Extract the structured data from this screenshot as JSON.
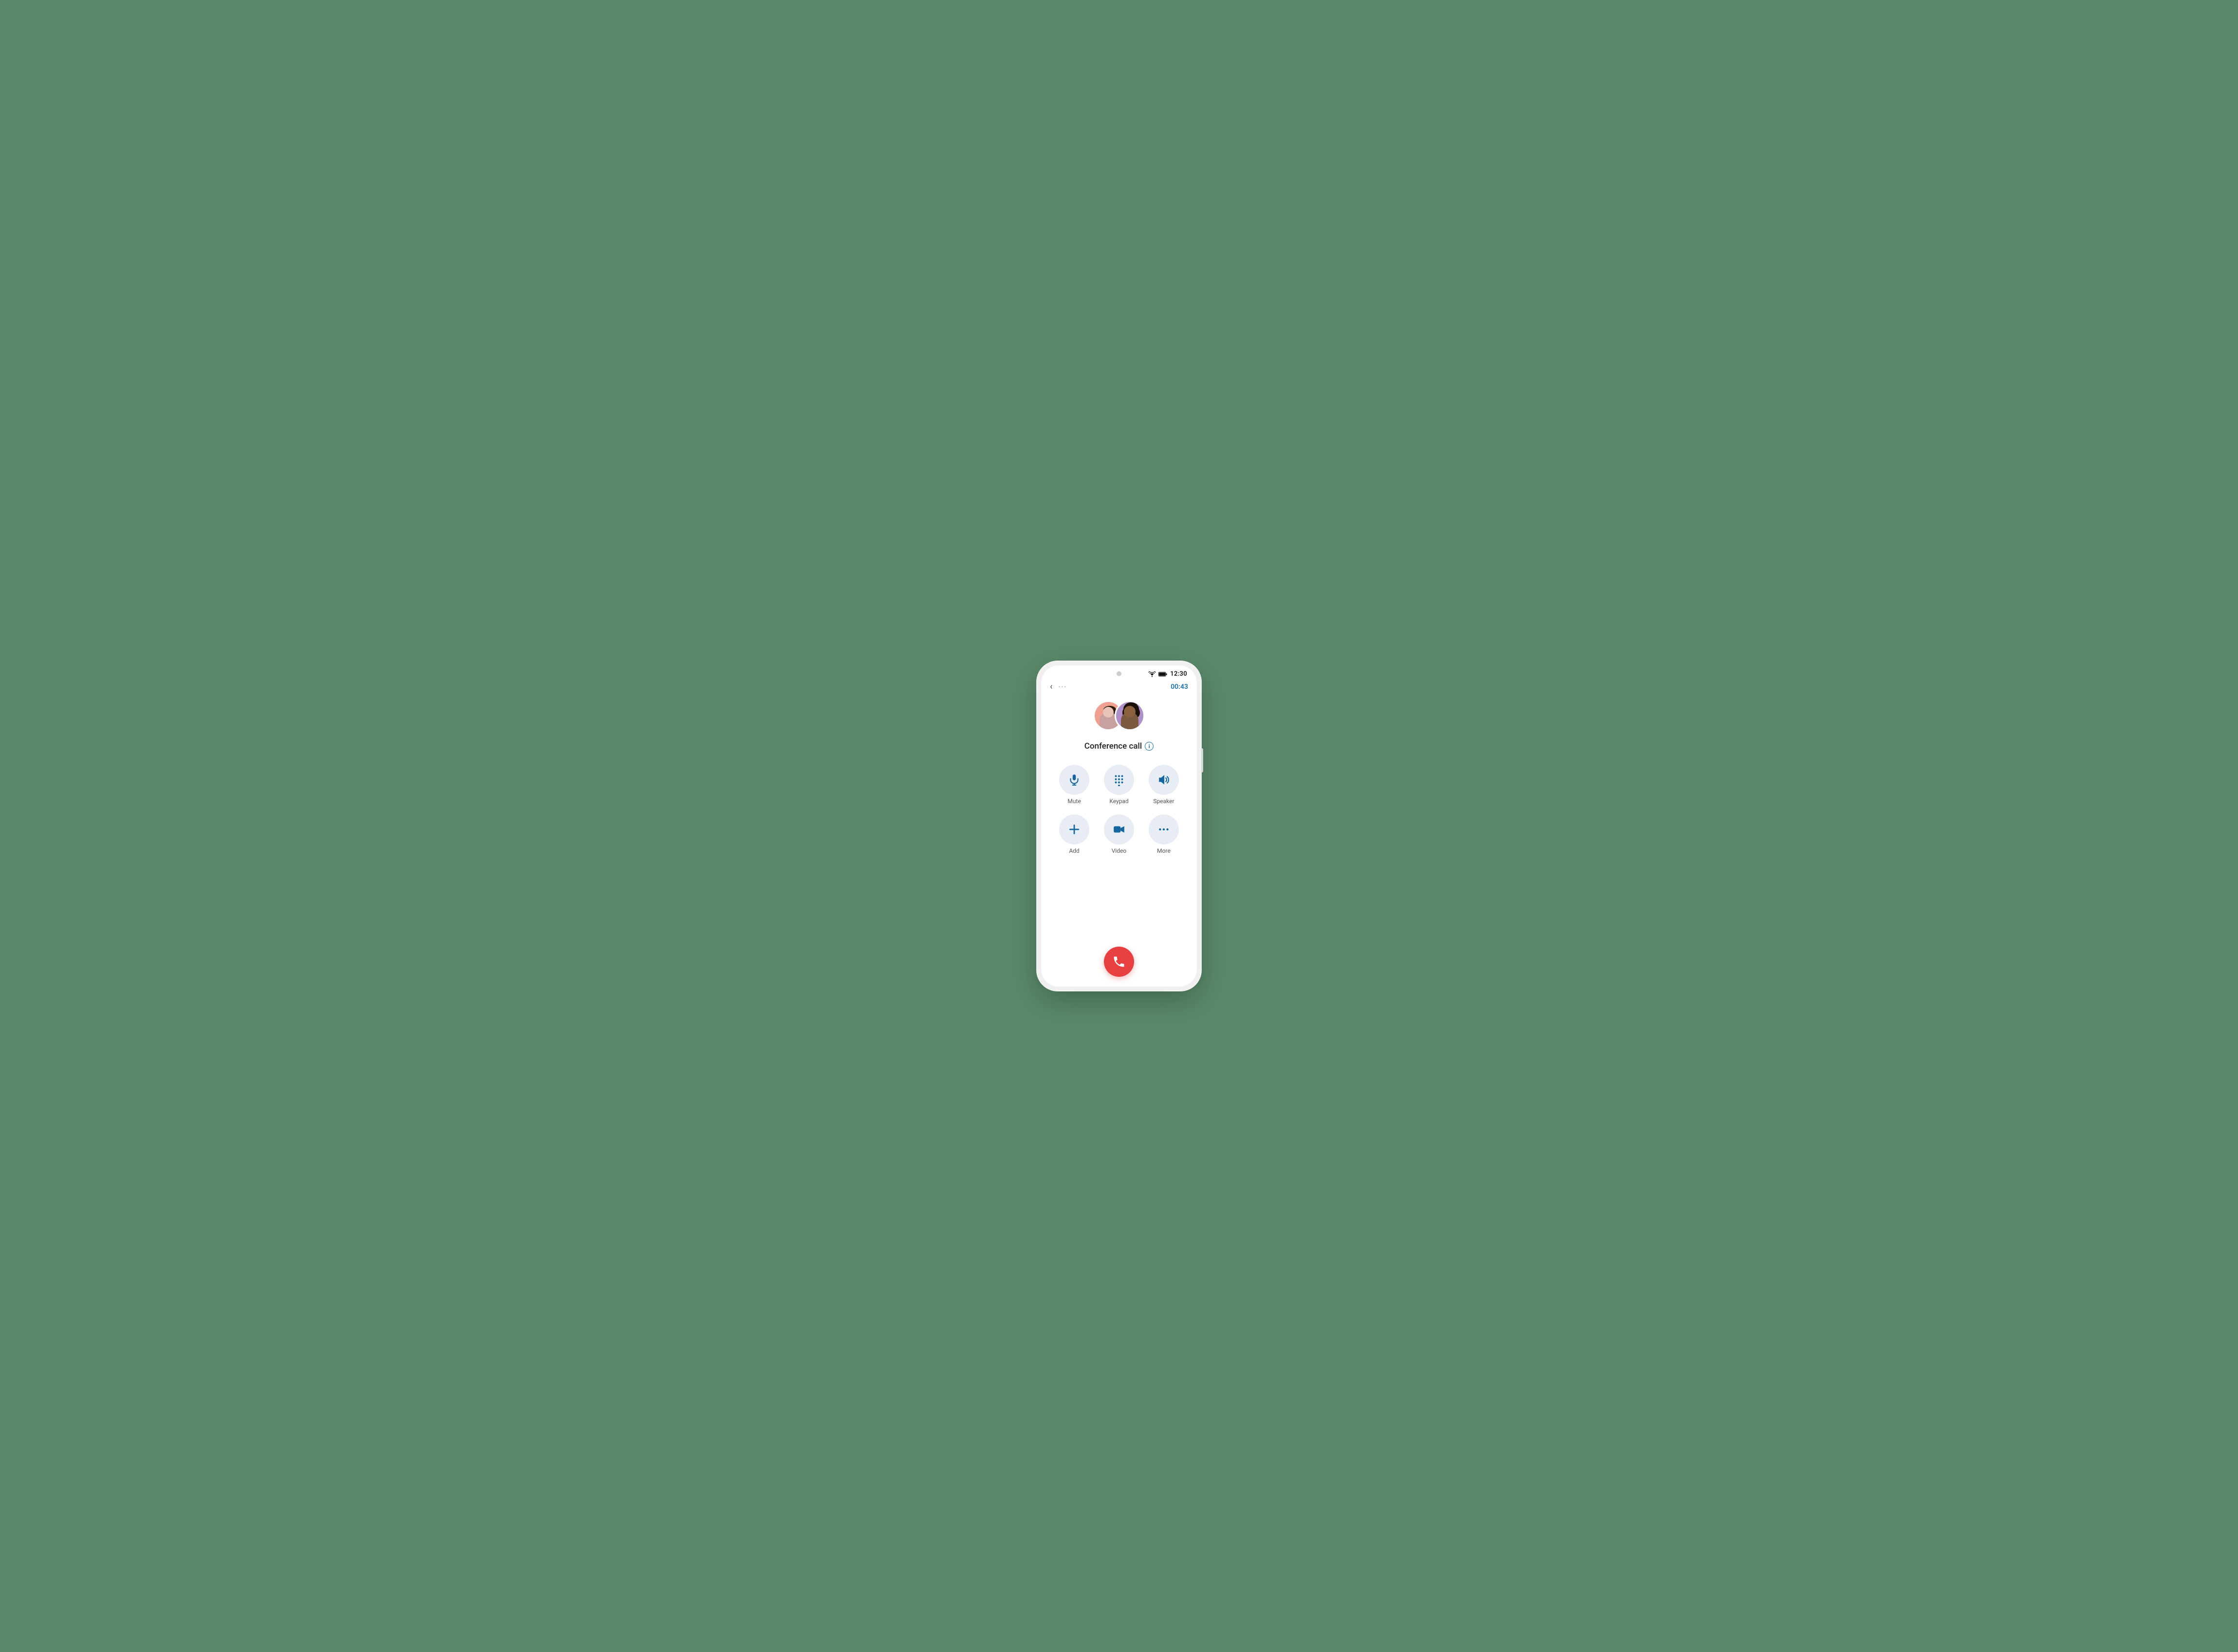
{
  "phone": {
    "status_bar": {
      "time": "12:30"
    },
    "top_bar": {
      "back_label": "‹",
      "menu_label": "···",
      "timer": "00:43"
    },
    "call": {
      "title": "Conference call",
      "info_icon_label": "i"
    },
    "controls": [
      {
        "id": "mute",
        "label": "Mute",
        "icon": "microphone"
      },
      {
        "id": "keypad",
        "label": "Keypad",
        "icon": "keypad"
      },
      {
        "id": "speaker",
        "label": "Speaker",
        "icon": "speaker"
      },
      {
        "id": "add",
        "label": "Add",
        "icon": "plus"
      },
      {
        "id": "video",
        "label": "Video",
        "icon": "video"
      },
      {
        "id": "more",
        "label": "More",
        "icon": "dots"
      }
    ],
    "end_call": {
      "label": "End call"
    }
  },
  "colors": {
    "accent": "#1a73a7",
    "end_call": "#e84040",
    "control_bg": "#e8edf5",
    "icon": "#1565a0"
  }
}
